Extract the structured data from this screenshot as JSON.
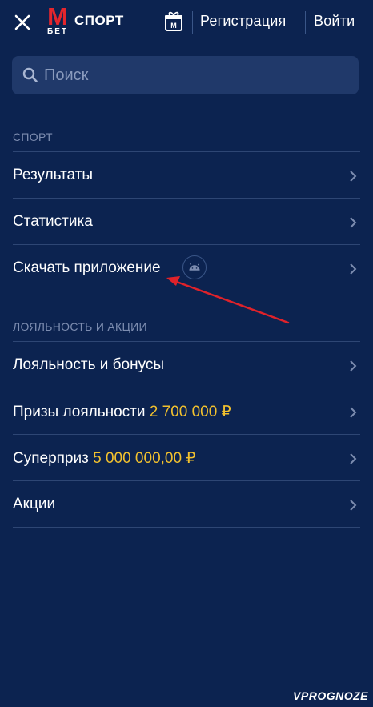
{
  "header": {
    "logo_letter": "M",
    "logo_sub": "БЕТ",
    "brand": "СПОРТ",
    "gift_badge": "M",
    "register_label": "Регистрация",
    "login_label": "Войти"
  },
  "search": {
    "placeholder": "Поиск"
  },
  "sections": [
    {
      "title": "СПОРТ",
      "items": [
        {
          "label": "Результаты"
        },
        {
          "label": "Статистика"
        },
        {
          "label": "Скачать приложение"
        }
      ]
    },
    {
      "title": "ЛОЯЛЬНОСТЬ И АКЦИИ",
      "items": [
        {
          "label": "Лояльность и бонусы"
        },
        {
          "label": "Призы лояльности",
          "value": "2 700 000 ₽"
        },
        {
          "label": "Суперприз",
          "value": "5 000 000,00 ₽"
        },
        {
          "label": "Акции"
        }
      ]
    }
  ],
  "watermark": "VPROGNOZE",
  "colors": {
    "background": "#0c2350",
    "accent_red": "#e4262d",
    "value_yellow": "#f2c12e",
    "annotation_arrow": "#e0222a"
  }
}
